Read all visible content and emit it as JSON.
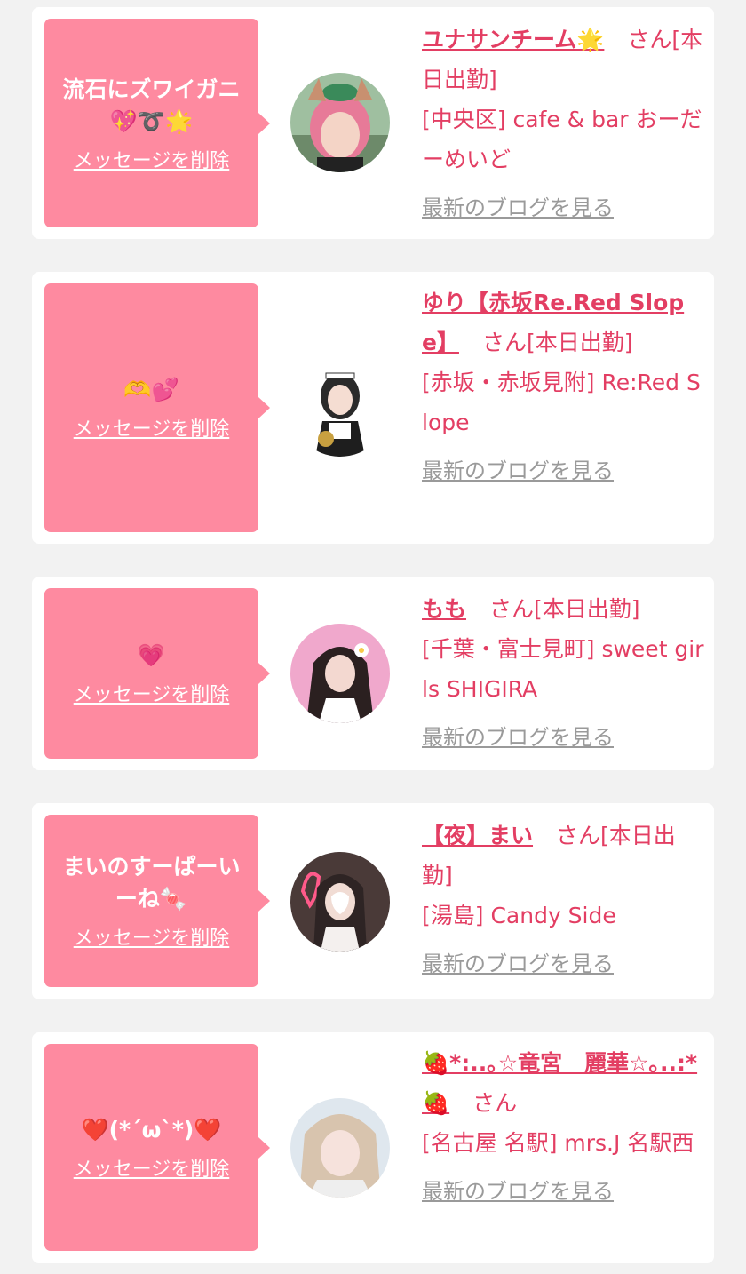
{
  "ui": {
    "delete_label": "メッセージを削除",
    "blog_label": "最新のブログを見る",
    "san": "さん"
  },
  "colors": {
    "accent_pink": "#fe8aa0",
    "text_pink": "#e33e63",
    "link_gray": "#9a9a9a"
  },
  "cards": [
    {
      "message": "流石にズワイガニ💖➰🌟",
      "name": "ユナサンチーム🌟",
      "status": "[本日出勤]",
      "location": "[中央区] cafe & bar おーだーめいど"
    },
    {
      "message": "🫶💕",
      "name": "ゆり【赤坂Re.Red Slope】",
      "status": "[本日出勤]",
      "location": "[赤坂・赤坂見附] Re:Red Slope"
    },
    {
      "message": "💗",
      "name": "もも",
      "status": "[本日出勤]",
      "location": "[千葉・富士見町] sweet girls SHIGIRA"
    },
    {
      "message": "まいのすーぱーいーね🍬",
      "name": "【夜】まい",
      "status": "[本日出勤]",
      "location": "[湯島] Candy Side"
    },
    {
      "message": "❤️(*´ω`*)❤️",
      "name": "🍓*:..｡☆竜宮　麗華☆｡..:*🍓",
      "status": "",
      "location": "[名古屋 名駅] mrs.J 名駅西"
    }
  ]
}
